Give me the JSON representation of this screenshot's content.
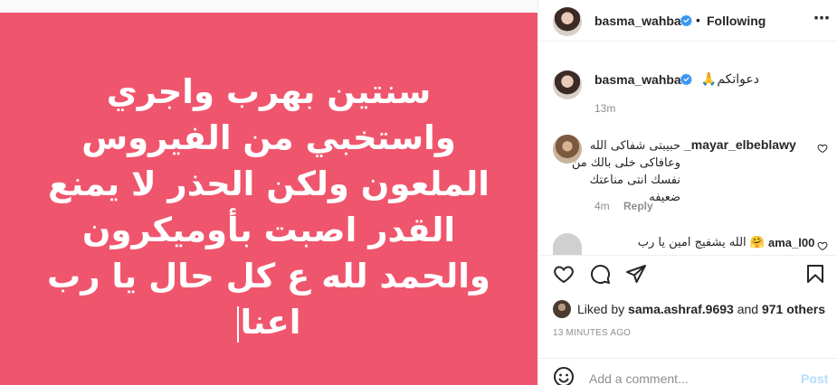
{
  "post": {
    "image_text_lines": [
      "سنتين بهرب واجري",
      "واستخبي من الفيروس",
      "الملعون ولكن الحذر لا يمنع",
      "القدر اصبت بأوميكرون",
      "والحمد لله ع كل حال يا رب",
      "اعنا"
    ],
    "background_color": "#ef566d"
  },
  "header": {
    "username": "basma_wahba",
    "separator": "•",
    "following_label": "Following",
    "more_icon": "more-horizontal-icon"
  },
  "caption": {
    "username": "basma_wahba",
    "text": "دعواتكم🙏",
    "time": "13m"
  },
  "comments": [
    {
      "username": "_mayar_elbeblawy",
      "text": "حبيبتى شفاكى الله وعافاكى خلى بالك من نفسك انتى مناعتك ضعيفه",
      "time": "4m",
      "reply_label": "Reply"
    },
    {
      "username": "ama_l00",
      "text": "🤗 الله يشفيج امين يا رب"
    }
  ],
  "likes": {
    "prefix": "Liked by",
    "liker": "sama.ashraf.9693",
    "joiner": "and",
    "others": "971 others"
  },
  "timeago": "13 MINUTES AGO",
  "add_comment": {
    "placeholder": "Add a comment...",
    "post_label": "Post"
  },
  "colors": {
    "verified": "#3897f0",
    "link_disabled": "#b2dffc",
    "secondary_text": "#8e8e8e"
  }
}
